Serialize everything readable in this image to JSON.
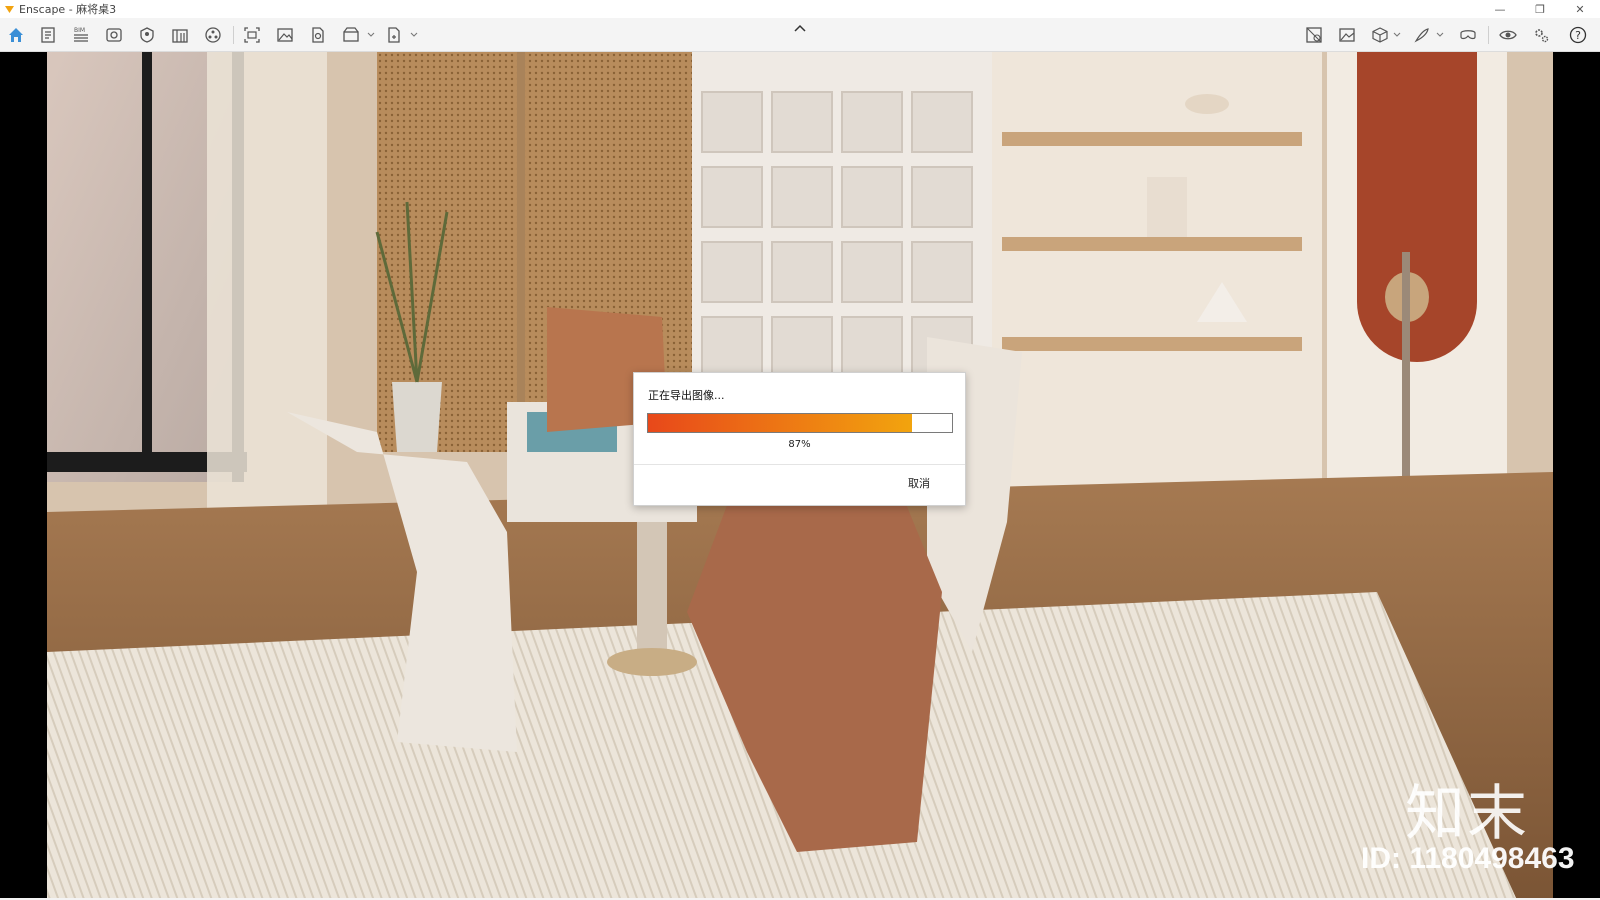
{
  "window": {
    "title": "Enscape - 麻将桌3",
    "minimize": "—",
    "maximize": "❐",
    "close": "✕"
  },
  "toolbar": {
    "left_icons": [
      "home-icon",
      "views-icon",
      "bim-icon",
      "visual-settings-icon",
      "atmosphere-icon",
      "library-icon",
      "asset-library-icon",
      "screenshot-icon",
      "batch-render-icon",
      "export-image-icon",
      "export-video-icon",
      "export-icon"
    ],
    "right_icons": [
      "site-context-icon",
      "material-editor-icon",
      "cube-icon",
      "draw-icon",
      "vr-headset-icon",
      "eye-icon",
      "settings-icon",
      "help-icon"
    ],
    "bim_label": "BIM",
    "help_symbol": "?"
  },
  "dialog": {
    "title": "正在导出图像...",
    "progress": 0.87,
    "progress_text": "87%",
    "cancel_label": "取消"
  },
  "watermark": {
    "logo_text": "知末",
    "id_text": "ID: 1180498463"
  },
  "colors": {
    "progress_start": "#e8481a",
    "progress_end": "#f2a40e",
    "accent_home": "#3b8fd6"
  }
}
